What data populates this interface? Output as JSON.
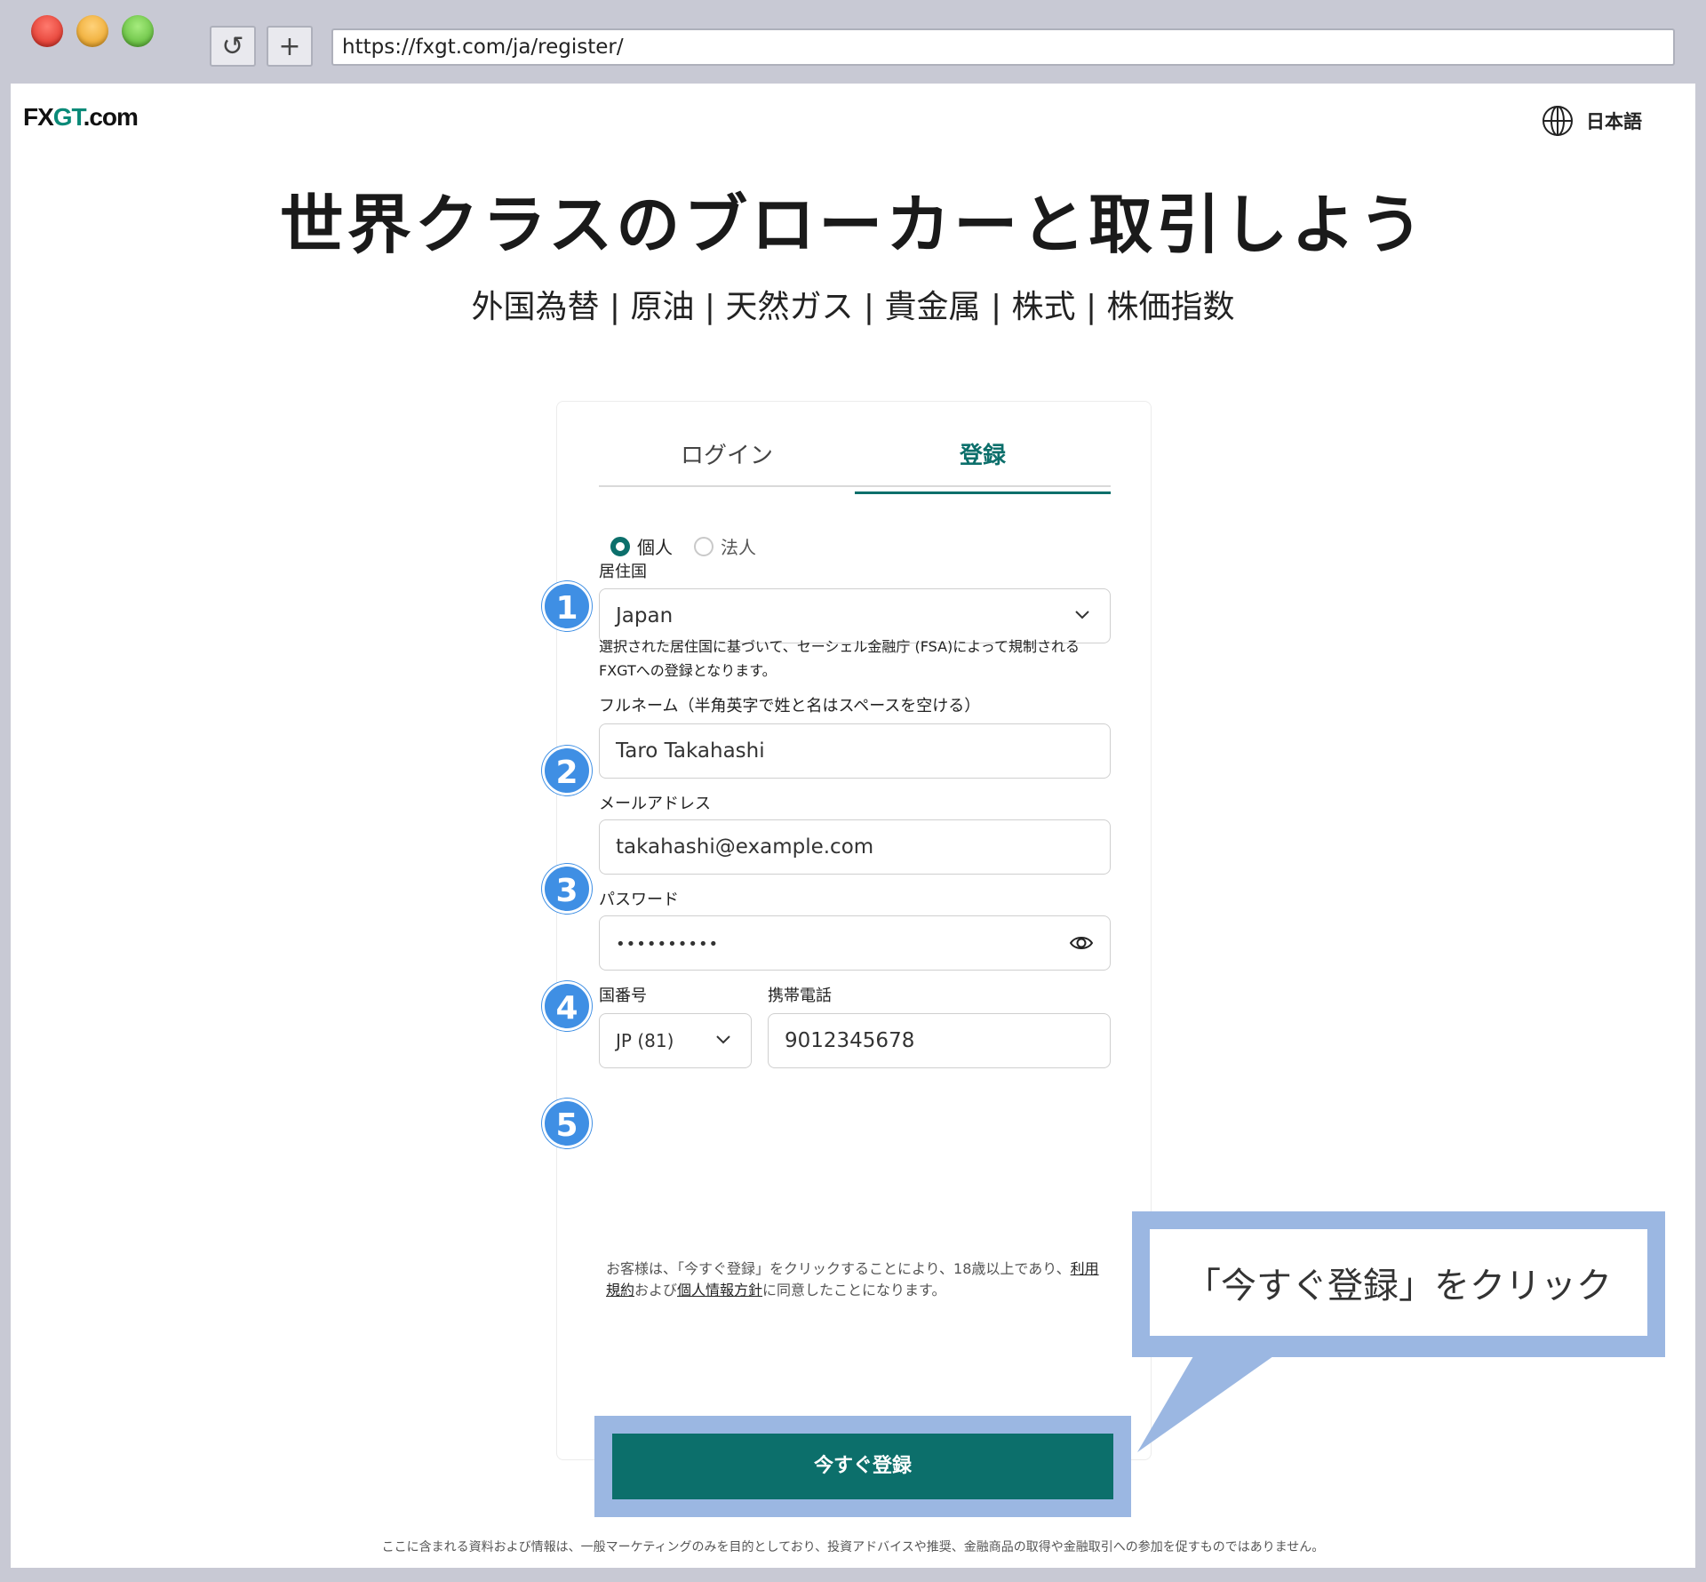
{
  "browser": {
    "url": "https://fxgt.com/ja/register/",
    "reload_glyph": "↺",
    "new_tab_glyph": "+"
  },
  "header": {
    "logo_prefix": "FX",
    "logo_gt": "GT",
    "logo_suffix": ".com",
    "language": "日本語"
  },
  "hero": {
    "title": "世界クラスのブローカーと取引しよう",
    "subtitle": "外国為替 | 原油 | 天然ガス | 貴金属 | 株式 | 株価指数"
  },
  "tabs": [
    {
      "label": "ログイン",
      "active": false
    },
    {
      "label": "登録",
      "active": true
    }
  ],
  "account_type": {
    "options": [
      "個人",
      "法人"
    ],
    "selected": "個人"
  },
  "steps": [
    "1",
    "2",
    "3",
    "4",
    "5"
  ],
  "form": {
    "country_label": "居住国",
    "country_value": "Japan",
    "country_note": "選択された居住国に基づいて、セーシェル金融庁 (FSA)によって規制されるFXGTへの登録となります。",
    "name_label": "フルネーム（半角英字で姓と名はスペースを空ける）",
    "name_value": "Taro Takahashi",
    "email_label": "メールアドレス",
    "email_value": "takahashi@example.com",
    "password_label": "パスワード",
    "password_value": "••••••••••",
    "country_code_label": "国番号",
    "country_code_value": "JP (81)",
    "phone_label": "携帯電話",
    "phone_value": "9012345678"
  },
  "legal": {
    "text_before": "お客様は、「今すぐ登録」をクリックすることにより、18歳以上であり、",
    "terms_link": "利用規約",
    "text_middle": "および",
    "privacy_link": "個人情報方針",
    "text_after": "に同意したことになります。"
  },
  "submit_label": "今すぐ登録",
  "callout": "「今すぐ登録」をクリック",
  "footer": "ここに含まれる資料および情報は、一般マーケティングのみを目的としており、投資アドバイスや推奨、金融商品の取得や金融取引への参加を促すものではありません。",
  "colors": {
    "brand": "#0c6f6b",
    "badge": "#3f8fe4",
    "highlight": "#9bb7e2"
  }
}
